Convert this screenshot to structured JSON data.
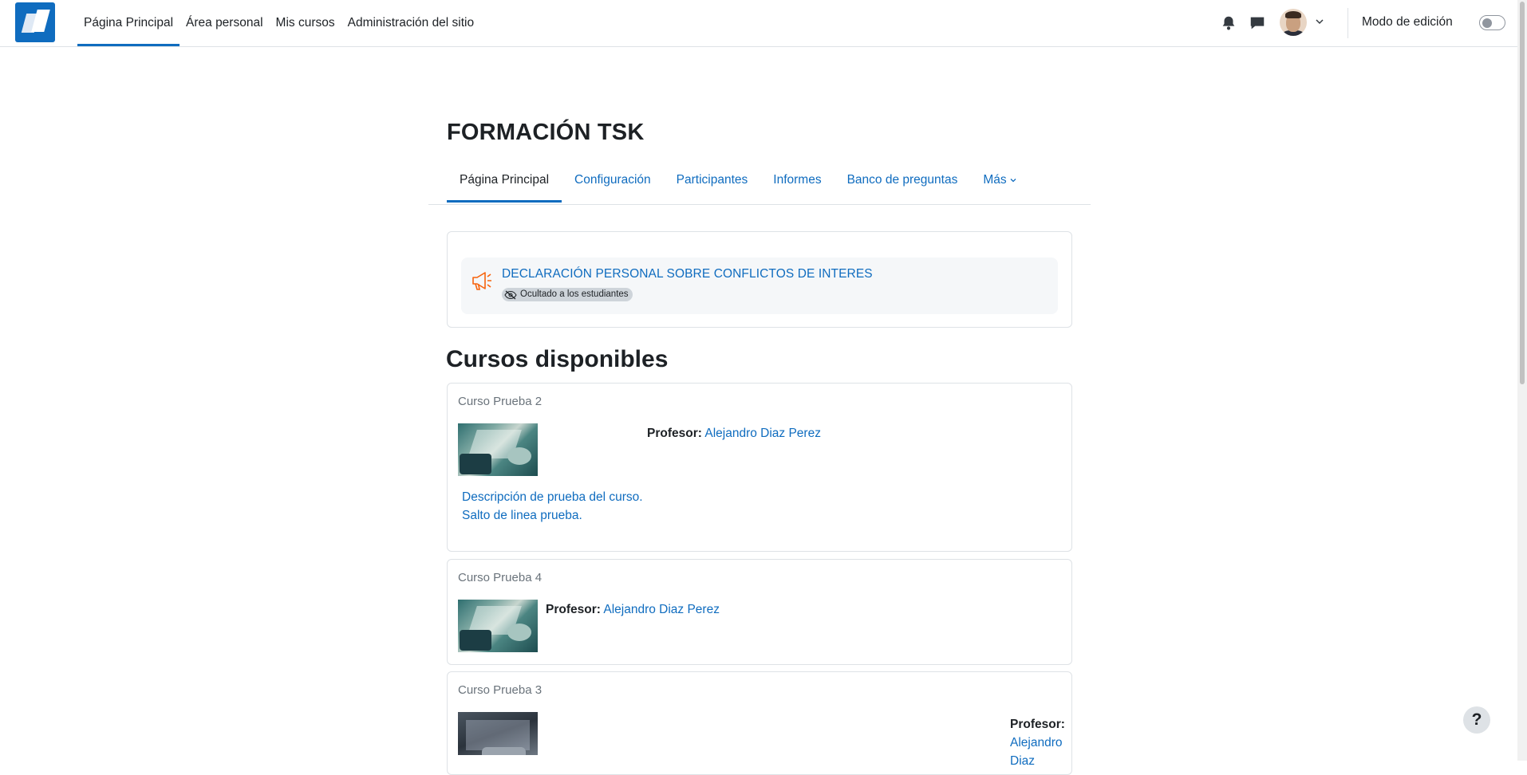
{
  "navbar": {
    "primary_items": [
      "Página Principal",
      "Área personal",
      "Mis cursos",
      "Administración del sitio"
    ],
    "edit_mode_label": "Modo de edición",
    "edit_mode_on": false
  },
  "course": {
    "title": "FORMACIÓN TSK",
    "tabs": [
      "Página Principal",
      "Configuración",
      "Participantes",
      "Informes",
      "Banco de preguntas",
      "Más"
    ]
  },
  "activity": {
    "name": "DECLARACIÓN PERSONAL SOBRE CONFLICTOS DE INTERES",
    "badge": "Ocultado a los estudiantes",
    "icon": "megaphone-icon"
  },
  "available": {
    "heading": "Cursos disponibles",
    "courses": [
      {
        "name": "Curso Prueba 2",
        "teacher_label": "Profesor:",
        "teacher": "Alejandro Diaz Perez",
        "description_lines": [
          "Descripción de prueba del curso.",
          "Salto de linea prueba."
        ]
      },
      {
        "name": "Curso Prueba 4",
        "teacher_label": "Profesor:",
        "teacher": "Alejandro Diaz Perez"
      },
      {
        "name": "Curso Prueba 3",
        "teacher_label": "Profesor:",
        "teacher_lines": [
          "Alejandro",
          "Diaz"
        ]
      }
    ]
  },
  "help": "?",
  "colors": {
    "brand": "#0f6cbf",
    "text": "#1d2125",
    "muted": "#6a737b",
    "activity_icon": "#f7630c"
  }
}
